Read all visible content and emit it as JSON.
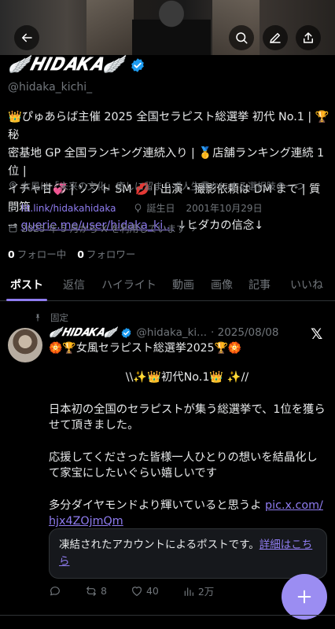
{
  "header": {
    "back_icon": "arrow-left-icon",
    "search_icon": "search-icon",
    "edit_icon": "pencil-icon",
    "share_icon": "share-icon"
  },
  "profile": {
    "display_name": "🪽𝑯𝑰𝑫𝑨𝑲𝑨🪽",
    "handle": "@hidaka_kichi_",
    "bio_line1": "👑ぴゅあらば主催 2025 全国セラピスト総選挙 初代 No.1 | 🏆秘",
    "bio_line2": "密基地 GP 全国ランキング連続入り | 🥇店舗ランキング連続 1 位 |",
    "bio_line3": "イチャ甘💞 | ソフト SM 💋 | 出演・撮影依頼は DM まで | 質問箱",
    "bio_line4_prefix": "⊸ ",
    "bio_link": "querie.me/user/hidaka_ki...",
    "bio_line4_suffix": " ↓ヒダカの信念↓",
    "location": "女風は「未来の文化」癒しに留まらず人生豊かにする選択肢の一つ",
    "website": "lit.link/hidakahidaka",
    "birthday_label": "誕生日",
    "birthday": "2001年10月29日",
    "joined": "2025 年 5 月から X を利用しています",
    "following_count": "0",
    "following_label": "フォロー中",
    "followers_count": "0",
    "followers_label": "フォロワー"
  },
  "tabs": [
    {
      "label": "ポスト",
      "active": true
    },
    {
      "label": "返信"
    },
    {
      "label": "ハイライト"
    },
    {
      "label": "動画"
    },
    {
      "label": "画像"
    },
    {
      "label": "記事"
    },
    {
      "label": "いいね"
    }
  ],
  "post": {
    "pinned_label": "固定",
    "author_name": "🪽𝑯𝑰𝑫𝑨𝑲𝑨🪽",
    "author_handle": "@hidaka_ki...",
    "date": "· 2025/08/08",
    "subtitle": "🏵️🏆女風セラピスト総選挙2025🏆🏵️",
    "line_title": "\\\\✨👑初代No.1👑 ✨//",
    "para1": "日本初の全国のセラピストが集う総選挙で、1位を獲らせて頂きました。",
    "para2": "応援してくださった皆様一人ひとりの想いを結晶化して家宝にしたいぐらい嬉しいです",
    "para3": "多分ダイヤモンドより輝いていると思うよ ",
    "link1": "pic.x.com/",
    "link2": "hjx4ZOjmQm",
    "notice_text": "凍結されたアカウントによるポストです。",
    "notice_link": "詳細はこちら",
    "reposts": "8",
    "likes": "40",
    "views": "2万"
  },
  "colors": {
    "accent": "#8f7cf0",
    "verified": "#1d9bf0",
    "fab": "#9b8df2"
  }
}
